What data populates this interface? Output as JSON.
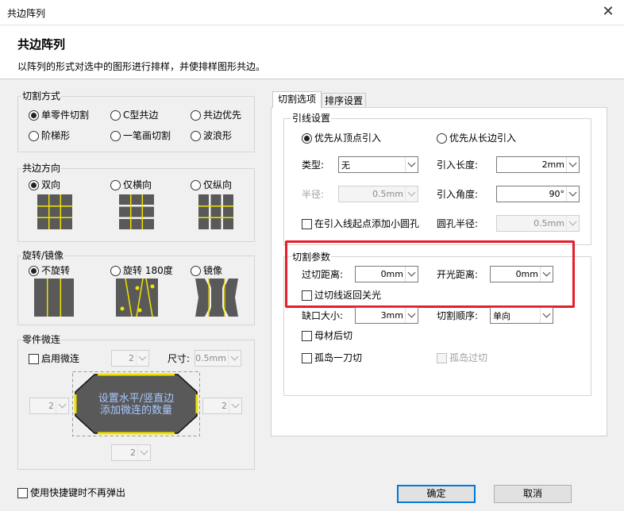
{
  "window": {
    "title": "共边阵列",
    "close_glyph": "✕"
  },
  "header": {
    "title": "共边阵列",
    "description": "以阵列的形式对选中的图形进行排样，并使排样图形共边。"
  },
  "cut_mode": {
    "title": "切割方式",
    "options": [
      {
        "label": "单零件切割",
        "selected": true
      },
      {
        "label": "C型共边",
        "selected": false
      },
      {
        "label": "共边优先",
        "selected": false
      },
      {
        "label": "阶梯形",
        "selected": false
      },
      {
        "label": "一笔画切割",
        "selected": false
      },
      {
        "label": "波浪形",
        "selected": false
      }
    ]
  },
  "edge_direction": {
    "title": "共边方向",
    "options": [
      {
        "label": "双向",
        "selected": true
      },
      {
        "label": "仅横向",
        "selected": false
      },
      {
        "label": "仅纵向",
        "selected": false
      }
    ]
  },
  "rotation": {
    "title": "旋转/镜像",
    "options": [
      {
        "label": "不旋转",
        "selected": true
      },
      {
        "label": "旋转 180度",
        "selected": false
      },
      {
        "label": "镜像",
        "selected": false
      }
    ]
  },
  "micro_joint": {
    "title": "零件微连",
    "enable_label": "启用微连",
    "enabled": false,
    "count_top": "2",
    "size_label": "尺寸:",
    "size_value": "0.5mm",
    "count_left": "2",
    "count_right": "2",
    "count_bottom": "2",
    "hint_line1": "设置水平/竖直边",
    "hint_line2": "添加微连的数量"
  },
  "tabs": [
    {
      "label": "切割选项",
      "active": true
    },
    {
      "label": "排序设置",
      "active": false
    }
  ],
  "lead": {
    "title": "引线设置",
    "from_vertex": "优先从顶点引入",
    "from_long_edge": "优先从长边引入",
    "type_label": "类型:",
    "type_value": "无",
    "length_label": "引入长度:",
    "length_value": "2mm",
    "radius_label": "半径:",
    "radius_value": "0.5mm",
    "angle_label": "引入角度:",
    "angle_value": "90°",
    "hole_label": "在引入线起点添加小圆孔",
    "hole_radius_label": "圆孔半径:",
    "hole_radius_value": "0.5mm"
  },
  "cut_params": {
    "title": "切割参数",
    "overcut_label": "过切距离:",
    "overcut_value": "0mm",
    "open_label": "开光距离:",
    "open_value": "0mm",
    "overcut_return_label": "过切线返回关光",
    "gap_label": "缺口大小:",
    "gap_value": "3mm",
    "order_label": "切割顺序:",
    "order_value": "单向",
    "base_cut_label": "母材后切",
    "island_one_label": "孤岛一刀切",
    "island_over_label": "孤岛过切"
  },
  "footer": {
    "no_popup_label": "使用快捷键时不再弹出",
    "ok_label": "确定",
    "cancel_label": "取消"
  },
  "colors": {
    "accent_red": "#e51e2b",
    "part_gray": "#595959",
    "edge_yellow": "#f2e200"
  }
}
